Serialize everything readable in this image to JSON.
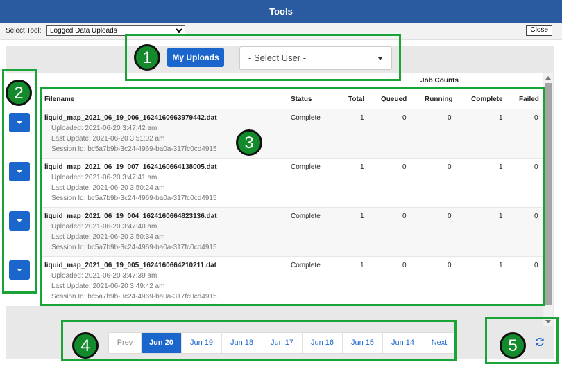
{
  "window": {
    "title": "Tools"
  },
  "toolbar": {
    "select_label": "Select Tool:",
    "selected_tool": "Logged Data Uploads",
    "close_label": "Close"
  },
  "filters": {
    "my_uploads_label": "My Uploads",
    "user_select_placeholder": "- Select User -"
  },
  "table": {
    "group_header": "Job Counts",
    "columns": [
      "Filename",
      "Status",
      "Total",
      "Queued",
      "Running",
      "Complete",
      "Failed"
    ],
    "rows": [
      {
        "filename": "liquid_map_2021_06_19_006_1624160663979442.dat",
        "uploaded": "Uploaded: 2021-06-20 3:47:42 am",
        "last_update": "Last Update: 2021-06-20 3:51:02 am",
        "session": "Session Id: bc5a7b9b-3c24-4969-ba0a-317fc0cd4915",
        "status": "Complete",
        "total": "1",
        "queued": "0",
        "running": "0",
        "complete": "1",
        "failed": "0"
      },
      {
        "filename": "liquid_map_2021_06_19_007_1624160664138005.dat",
        "uploaded": "Uploaded: 2021-06-20 3:47:41 am",
        "last_update": "Last Update: 2021-06-20 3:50:24 am",
        "session": "Session Id: bc5a7b9b-3c24-4969-ba0a-317fc0cd4915",
        "status": "Complete",
        "total": "1",
        "queued": "0",
        "running": "0",
        "complete": "1",
        "failed": "0"
      },
      {
        "filename": "liquid_map_2021_06_19_004_1624160664823136.dat",
        "uploaded": "Uploaded: 2021-06-20 3:47:40 am",
        "last_update": "Last Update: 2021-06-20 3:50:34 am",
        "session": "Session Id: bc5a7b9b-3c24-4969-ba0a-317fc0cd4915",
        "status": "Complete",
        "total": "1",
        "queued": "0",
        "running": "0",
        "complete": "1",
        "failed": "0"
      },
      {
        "filename": "liquid_map_2021_06_19_005_1624160664210211.dat",
        "uploaded": "Uploaded: 2021-06-20 3:47:39 am",
        "last_update": "Last Update: 2021-06-20 3:49:42 am",
        "session": "Session Id: bc5a7b9b-3c24-4969-ba0a-317fc0cd4915",
        "status": "Complete",
        "total": "1",
        "queued": "0",
        "running": "0",
        "complete": "1",
        "failed": "0"
      }
    ]
  },
  "pagination": {
    "prev": "Prev",
    "pages": [
      "Jun 20",
      "Jun 19",
      "Jun 18",
      "Jun 17",
      "Jun 16",
      "Jun 15",
      "Jun 14"
    ],
    "active": "Jun 20",
    "next": "Next"
  },
  "refresh": {
    "icon": "refresh-icon"
  },
  "annotations": {
    "labels": [
      "1",
      "2",
      "3",
      "4",
      "5"
    ],
    "color": "#1aa337"
  },
  "colors": {
    "accent": "#1a66cc",
    "titlebar": "#2a5aa0"
  }
}
